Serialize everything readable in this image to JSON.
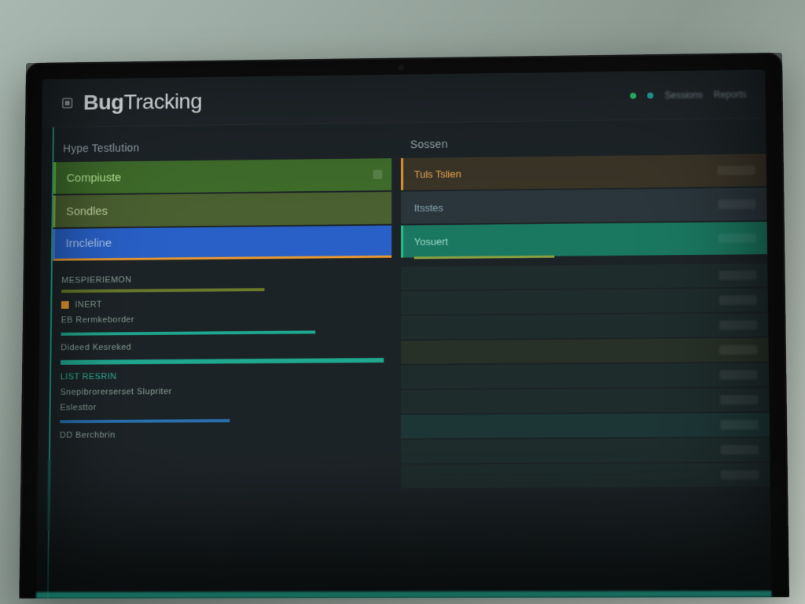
{
  "app": {
    "title_bold": "Bug",
    "title_thin": "Tracking"
  },
  "header": {
    "links": [
      "Sessions",
      "Reports"
    ]
  },
  "sidebar": {
    "section_heading": "Hype Testlution",
    "items": [
      {
        "id": "complete",
        "label": "Compiuste"
      },
      {
        "id": "sources",
        "label": "Sondles"
      },
      {
        "id": "timeline",
        "label": "Irncleline"
      }
    ],
    "sub_section": "MESPIERIEMON",
    "sub_items": [
      {
        "label": "INERT"
      },
      {
        "label": "EB Rermkeborder"
      },
      {
        "label": "Dideed Kesreked"
      },
      {
        "label": "LIST RESRIN"
      },
      {
        "label": "Snepibrorerserset Slupriter"
      },
      {
        "label": "Eslesttor"
      },
      {
        "label": "DD Berchbrin"
      }
    ]
  },
  "right_panel": {
    "heading": "Sossen",
    "rows": [
      {
        "label": "Tuls Tslien",
        "style": "orange"
      },
      {
        "label": "Itsstes",
        "style": "slate"
      },
      {
        "label": "Yosuert",
        "style": "green"
      }
    ],
    "list_items": [
      "",
      "",
      "",
      "",
      "",
      "",
      "",
      "",
      ""
    ]
  },
  "colors": {
    "teal": "#1fa890",
    "green": "#3e6b2a",
    "olive": "#6a7a2a",
    "blue": "#2860c8",
    "orange": "#e89830",
    "bg": "#1c2326"
  }
}
